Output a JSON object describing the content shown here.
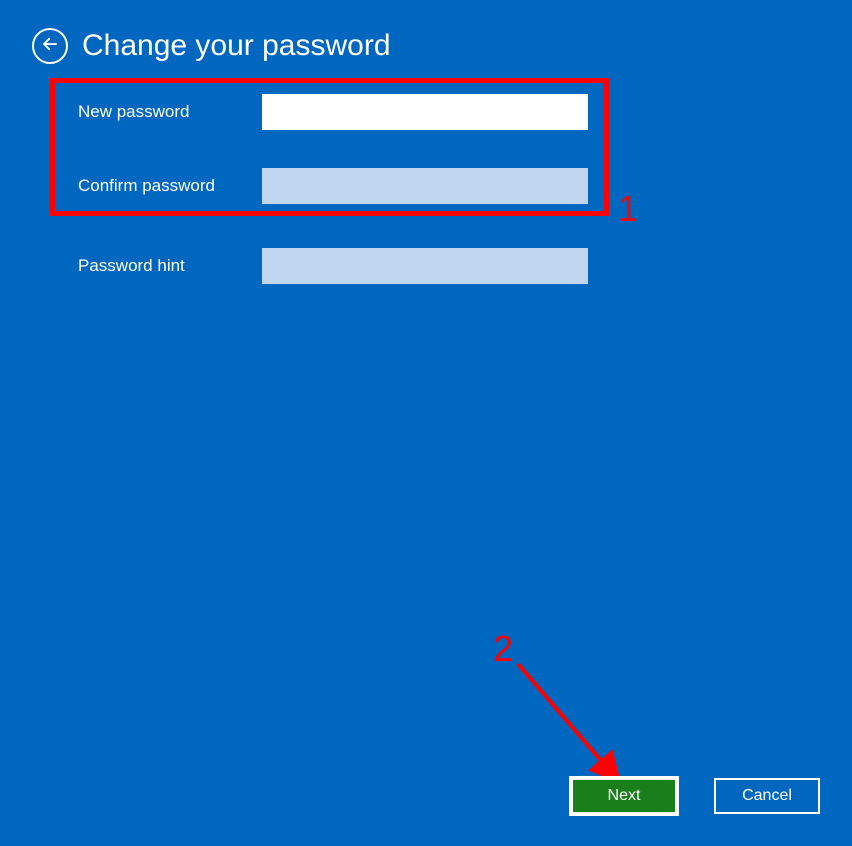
{
  "header": {
    "title": "Change your password"
  },
  "form": {
    "newPassword": {
      "label": "New password",
      "value": ""
    },
    "confirmPassword": {
      "label": "Confirm password",
      "value": ""
    },
    "passwordHint": {
      "label": "Password hint",
      "value": ""
    }
  },
  "buttons": {
    "next": "Next",
    "cancel": "Cancel"
  },
  "annotations": {
    "label1": "1",
    "label2": "2"
  }
}
